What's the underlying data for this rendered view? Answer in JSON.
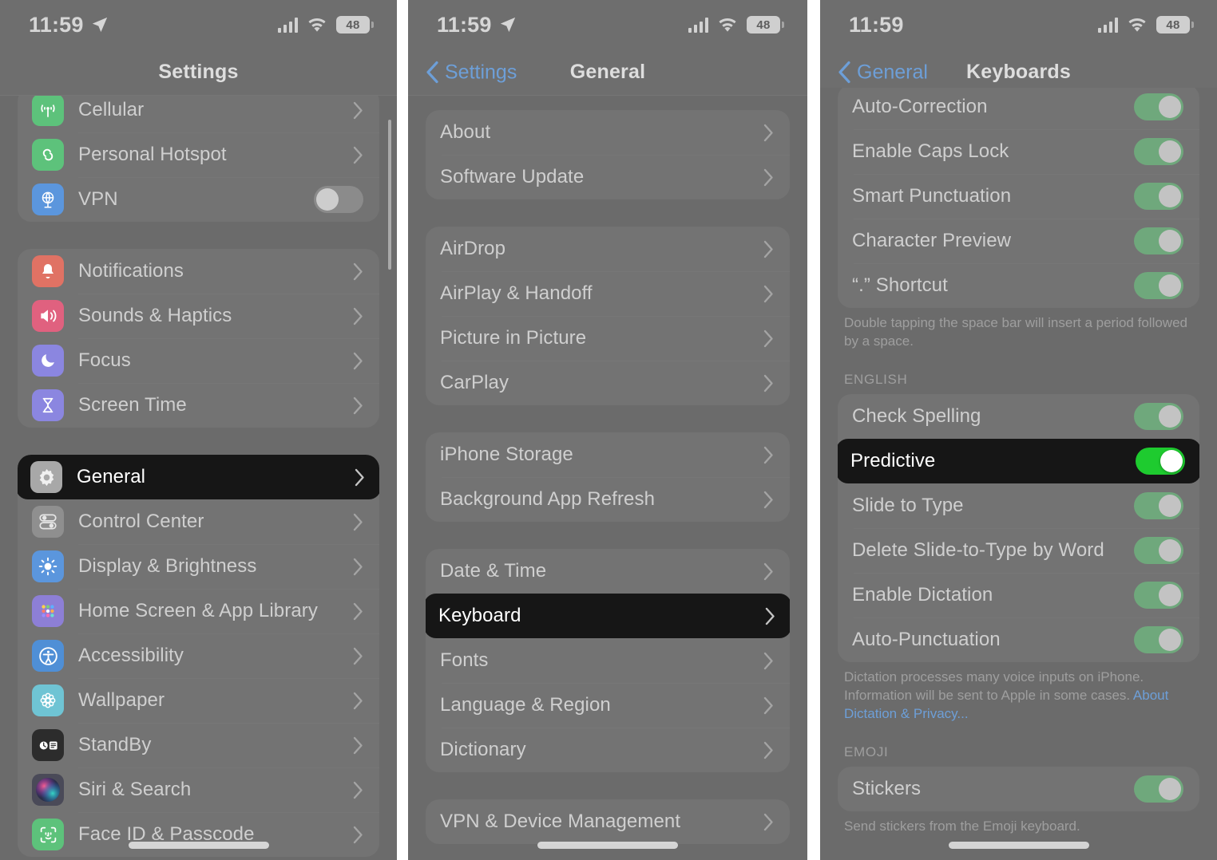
{
  "meta": {
    "accent_blue": "#6d9fd8",
    "highlight_bg": "#161616",
    "toggle_on_dim": "#6fa87c",
    "toggle_on_bright": "#1ecb2f",
    "screen_bg": "#6b6b6b"
  },
  "status_bar": {
    "time": "11:59",
    "battery_level": "48",
    "location_icon": "location-arrow-icon",
    "signal_icon": "cellular-signal-icon",
    "wifi_icon": "wifi-icon",
    "battery_icon": "battery-icon"
  },
  "panel1": {
    "nav": {
      "title": "Settings"
    },
    "groups": [
      {
        "rows": [
          {
            "label": "Cellular",
            "icon": "cellular-icon",
            "accessory": "chevron"
          },
          {
            "label": "Personal Hotspot",
            "icon": "personal-hotspot-icon",
            "accessory": "chevron"
          },
          {
            "label": "VPN",
            "icon": "vpn-icon",
            "accessory": "toggle",
            "toggle": "off"
          }
        ]
      },
      {
        "rows": [
          {
            "label": "Notifications",
            "icon": "notifications-icon",
            "accessory": "chevron"
          },
          {
            "label": "Sounds & Haptics",
            "icon": "sounds-icon",
            "accessory": "chevron"
          },
          {
            "label": "Focus",
            "icon": "focus-icon",
            "accessory": "chevron"
          },
          {
            "label": "Screen Time",
            "icon": "screen-time-icon",
            "accessory": "chevron"
          }
        ]
      },
      {
        "rows": [
          {
            "label": "General",
            "icon": "general-gear-icon",
            "accessory": "chevron",
            "highlighted": true
          },
          {
            "label": "Control Center",
            "icon": "control-center-icon",
            "accessory": "chevron"
          },
          {
            "label": "Display & Brightness",
            "icon": "display-icon",
            "accessory": "chevron"
          },
          {
            "label": "Home Screen & App Library",
            "icon": "home-screen-icon",
            "accessory": "chevron"
          },
          {
            "label": "Accessibility",
            "icon": "accessibility-icon",
            "accessory": "chevron"
          },
          {
            "label": "Wallpaper",
            "icon": "wallpaper-icon",
            "accessory": "chevron"
          },
          {
            "label": "StandBy",
            "icon": "standby-icon",
            "accessory": "chevron"
          },
          {
            "label": "Siri & Search",
            "icon": "siri-icon",
            "accessory": "chevron"
          },
          {
            "label": "Face ID & Passcode",
            "icon": "face-id-icon",
            "accessory": "chevron"
          }
        ]
      }
    ]
  },
  "panel2": {
    "nav": {
      "back_label": "Settings",
      "title": "General"
    },
    "groups": [
      {
        "rows": [
          {
            "label": "About",
            "accessory": "chevron"
          },
          {
            "label": "Software Update",
            "accessory": "chevron"
          }
        ]
      },
      {
        "rows": [
          {
            "label": "AirDrop",
            "accessory": "chevron"
          },
          {
            "label": "AirPlay & Handoff",
            "accessory": "chevron"
          },
          {
            "label": "Picture in Picture",
            "accessory": "chevron"
          },
          {
            "label": "CarPlay",
            "accessory": "chevron"
          }
        ]
      },
      {
        "rows": [
          {
            "label": "iPhone Storage",
            "accessory": "chevron"
          },
          {
            "label": "Background App Refresh",
            "accessory": "chevron"
          }
        ]
      },
      {
        "rows": [
          {
            "label": "Date & Time",
            "accessory": "chevron"
          },
          {
            "label": "Keyboard",
            "accessory": "chevron",
            "highlighted": true
          },
          {
            "label": "Fonts",
            "accessory": "chevron"
          },
          {
            "label": "Language & Region",
            "accessory": "chevron"
          },
          {
            "label": "Dictionary",
            "accessory": "chevron"
          }
        ]
      },
      {
        "rows": [
          {
            "label": "VPN & Device Management",
            "accessory": "chevron"
          }
        ]
      }
    ]
  },
  "panel3": {
    "nav": {
      "back_label": "General",
      "title": "Keyboards"
    },
    "groups": [
      {
        "rows": [
          {
            "label": "Auto-Correction",
            "accessory": "toggle",
            "toggle": "on"
          },
          {
            "label": "Enable Caps Lock",
            "accessory": "toggle",
            "toggle": "on"
          },
          {
            "label": "Smart Punctuation",
            "accessory": "toggle",
            "toggle": "on"
          },
          {
            "label": "Character Preview",
            "accessory": "toggle",
            "toggle": "on"
          },
          {
            "label": "“.” Shortcut",
            "accessory": "toggle",
            "toggle": "on"
          }
        ]
      }
    ],
    "footnote_shortcut": "Double tapping the space bar will insert a period followed by a space.",
    "section_english": "ENGLISH",
    "english_rows": [
      {
        "label": "Check Spelling",
        "accessory": "toggle",
        "toggle": "on"
      },
      {
        "label": "Predictive",
        "accessory": "toggle",
        "toggle": "bright",
        "highlighted": true
      },
      {
        "label": "Slide to Type",
        "accessory": "toggle",
        "toggle": "on"
      },
      {
        "label": "Delete Slide-to-Type by Word",
        "accessory": "toggle",
        "toggle": "on"
      },
      {
        "label": "Enable Dictation",
        "accessory": "toggle",
        "toggle": "on"
      },
      {
        "label": "Auto-Punctuation",
        "accessory": "toggle",
        "toggle": "on"
      }
    ],
    "footnote_dictation_text": "Dictation processes many voice inputs on iPhone. Information will be sent to Apple in some cases. ",
    "footnote_dictation_link": "About Dictation & Privacy...",
    "section_emoji": "EMOJI",
    "emoji_rows": [
      {
        "label": "Stickers",
        "accessory": "toggle",
        "toggle": "on"
      }
    ],
    "footnote_emoji": "Send stickers from the Emoji keyboard."
  }
}
